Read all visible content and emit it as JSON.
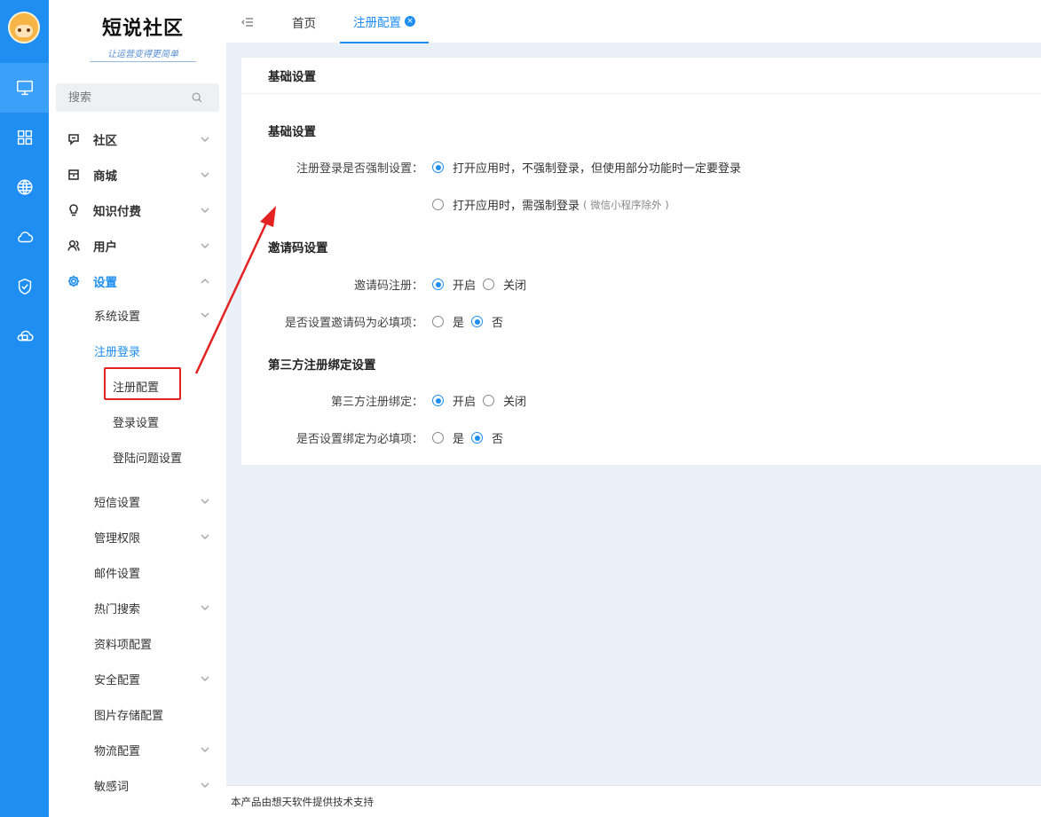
{
  "brand": {
    "name": "短说社区",
    "slogan": "让运营变得更简单"
  },
  "search": {
    "placeholder": "搜索"
  },
  "menu": [
    {
      "label": "社区",
      "icon": "chat-icon"
    },
    {
      "label": "商城",
      "icon": "store-icon"
    },
    {
      "label": "知识付费",
      "icon": "bulb-icon"
    },
    {
      "label": "用户",
      "icon": "users-icon"
    },
    {
      "label": "设置",
      "icon": "gear-icon"
    }
  ],
  "settings_sub": [
    "系统设置",
    "注册登录",
    "短信设置",
    "管理权限",
    "邮件设置",
    "热门搜索",
    "资料项配置",
    "安全配置",
    "图片存储配置",
    "物流配置",
    "敏感词"
  ],
  "register_sub": [
    "注册配置",
    "登录设置",
    "登陆问题设置"
  ],
  "tabs": {
    "home": "首页",
    "active": "注册配置"
  },
  "card": {
    "header": "基础设置",
    "section_basic": "基础设置",
    "force_login_label": "注册登录是否强制设置：",
    "force_opt1": "打开应用时，不强制登录，但使用部分功能时一定要登录",
    "force_opt2": "打开应用时，需强制登录",
    "force_opt2_note": "( 微信小程序除外 )",
    "section_invite": "邀请码设置",
    "invite_label": "邀请码注册：",
    "invite_required_label": "是否设置邀请码为必填项：",
    "section_third": "第三方注册绑定设置",
    "third_label": "第三方注册绑定：",
    "third_required_label": "是否设置绑定为必填项：",
    "opt_on": "开启",
    "opt_off": "关闭",
    "opt_yes": "是",
    "opt_no": "否"
  },
  "footer": "本产品由想天软件提供技术支持",
  "colors": {
    "rail": "#1e8ef2",
    "accent": "#1e8ef2",
    "annotation": "#e32222",
    "main_bg": "#eaf0f8"
  }
}
